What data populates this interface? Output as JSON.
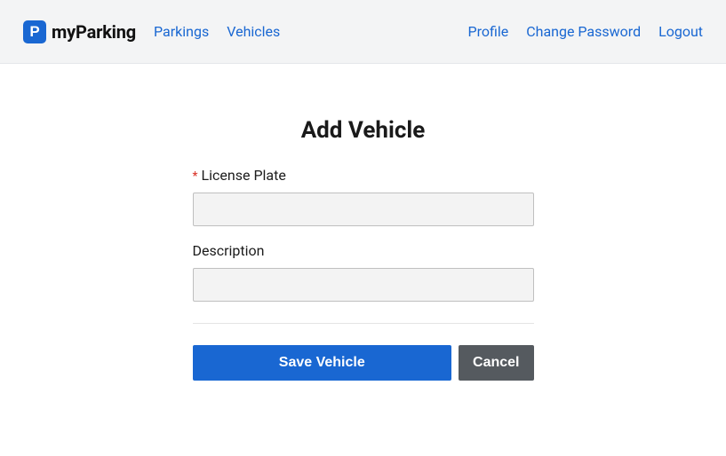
{
  "brand": {
    "logo_letter": "P",
    "name": "myParking"
  },
  "nav": {
    "left": [
      {
        "label": "Parkings"
      },
      {
        "label": "Vehicles"
      }
    ],
    "right": [
      {
        "label": "Profile"
      },
      {
        "label": "Change Password"
      },
      {
        "label": "Logout"
      }
    ]
  },
  "page": {
    "title": "Add Vehicle"
  },
  "form": {
    "license_plate": {
      "label": "License Plate",
      "required_mark": "*",
      "value": ""
    },
    "description": {
      "label": "Description",
      "value": ""
    },
    "save_label": "Save Vehicle",
    "cancel_label": "Cancel"
  }
}
